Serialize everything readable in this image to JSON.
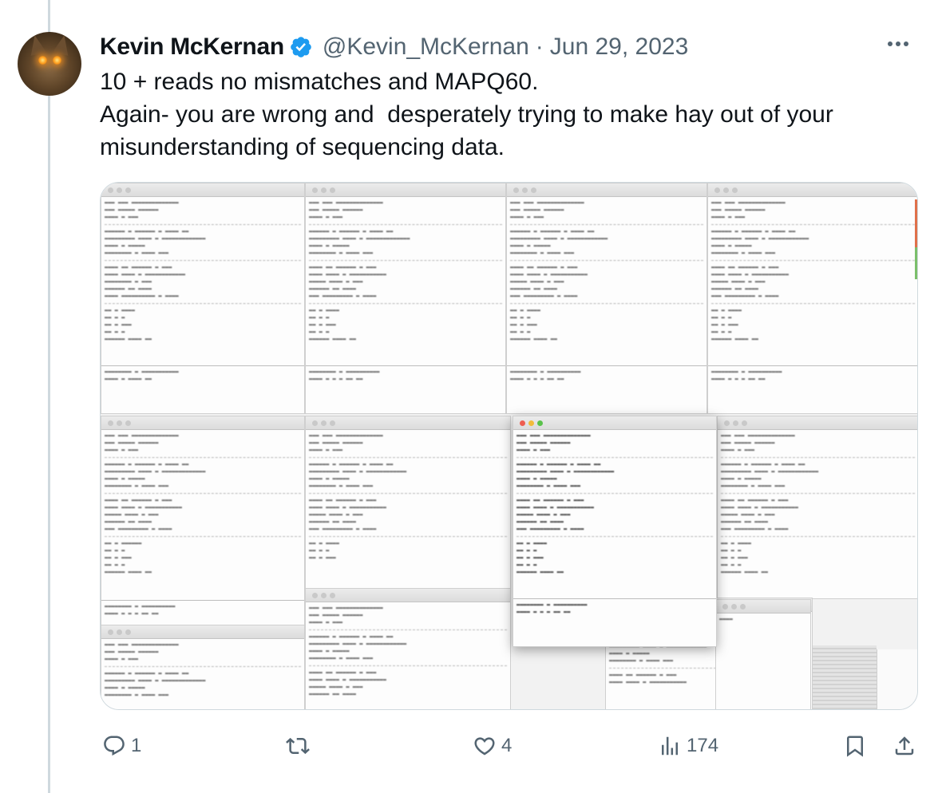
{
  "tweet": {
    "author_name": "Kevin McKernan",
    "handle": "@Kevin_McKernan",
    "separator": "·",
    "date": "Jun 29, 2023",
    "text_lines": [
      "10 + reads no mismatches and MAPQ60.",
      "Again- you are wrong and  desperately trying to make hay out of your",
      "misunderstanding of sequencing data."
    ]
  },
  "actions": {
    "reply_count": "1",
    "repost_count": "",
    "like_count": "4",
    "views_count": "174"
  },
  "colors": {
    "verified": "#1d9bf0",
    "muted": "#536471",
    "text": "#0f1419",
    "divider": "#cfd9de"
  },
  "icons": [
    "avatar",
    "verified-badge-icon",
    "more-icon",
    "reply-icon",
    "repost-icon",
    "like-icon",
    "views-icon",
    "bookmark-icon",
    "share-icon"
  ]
}
